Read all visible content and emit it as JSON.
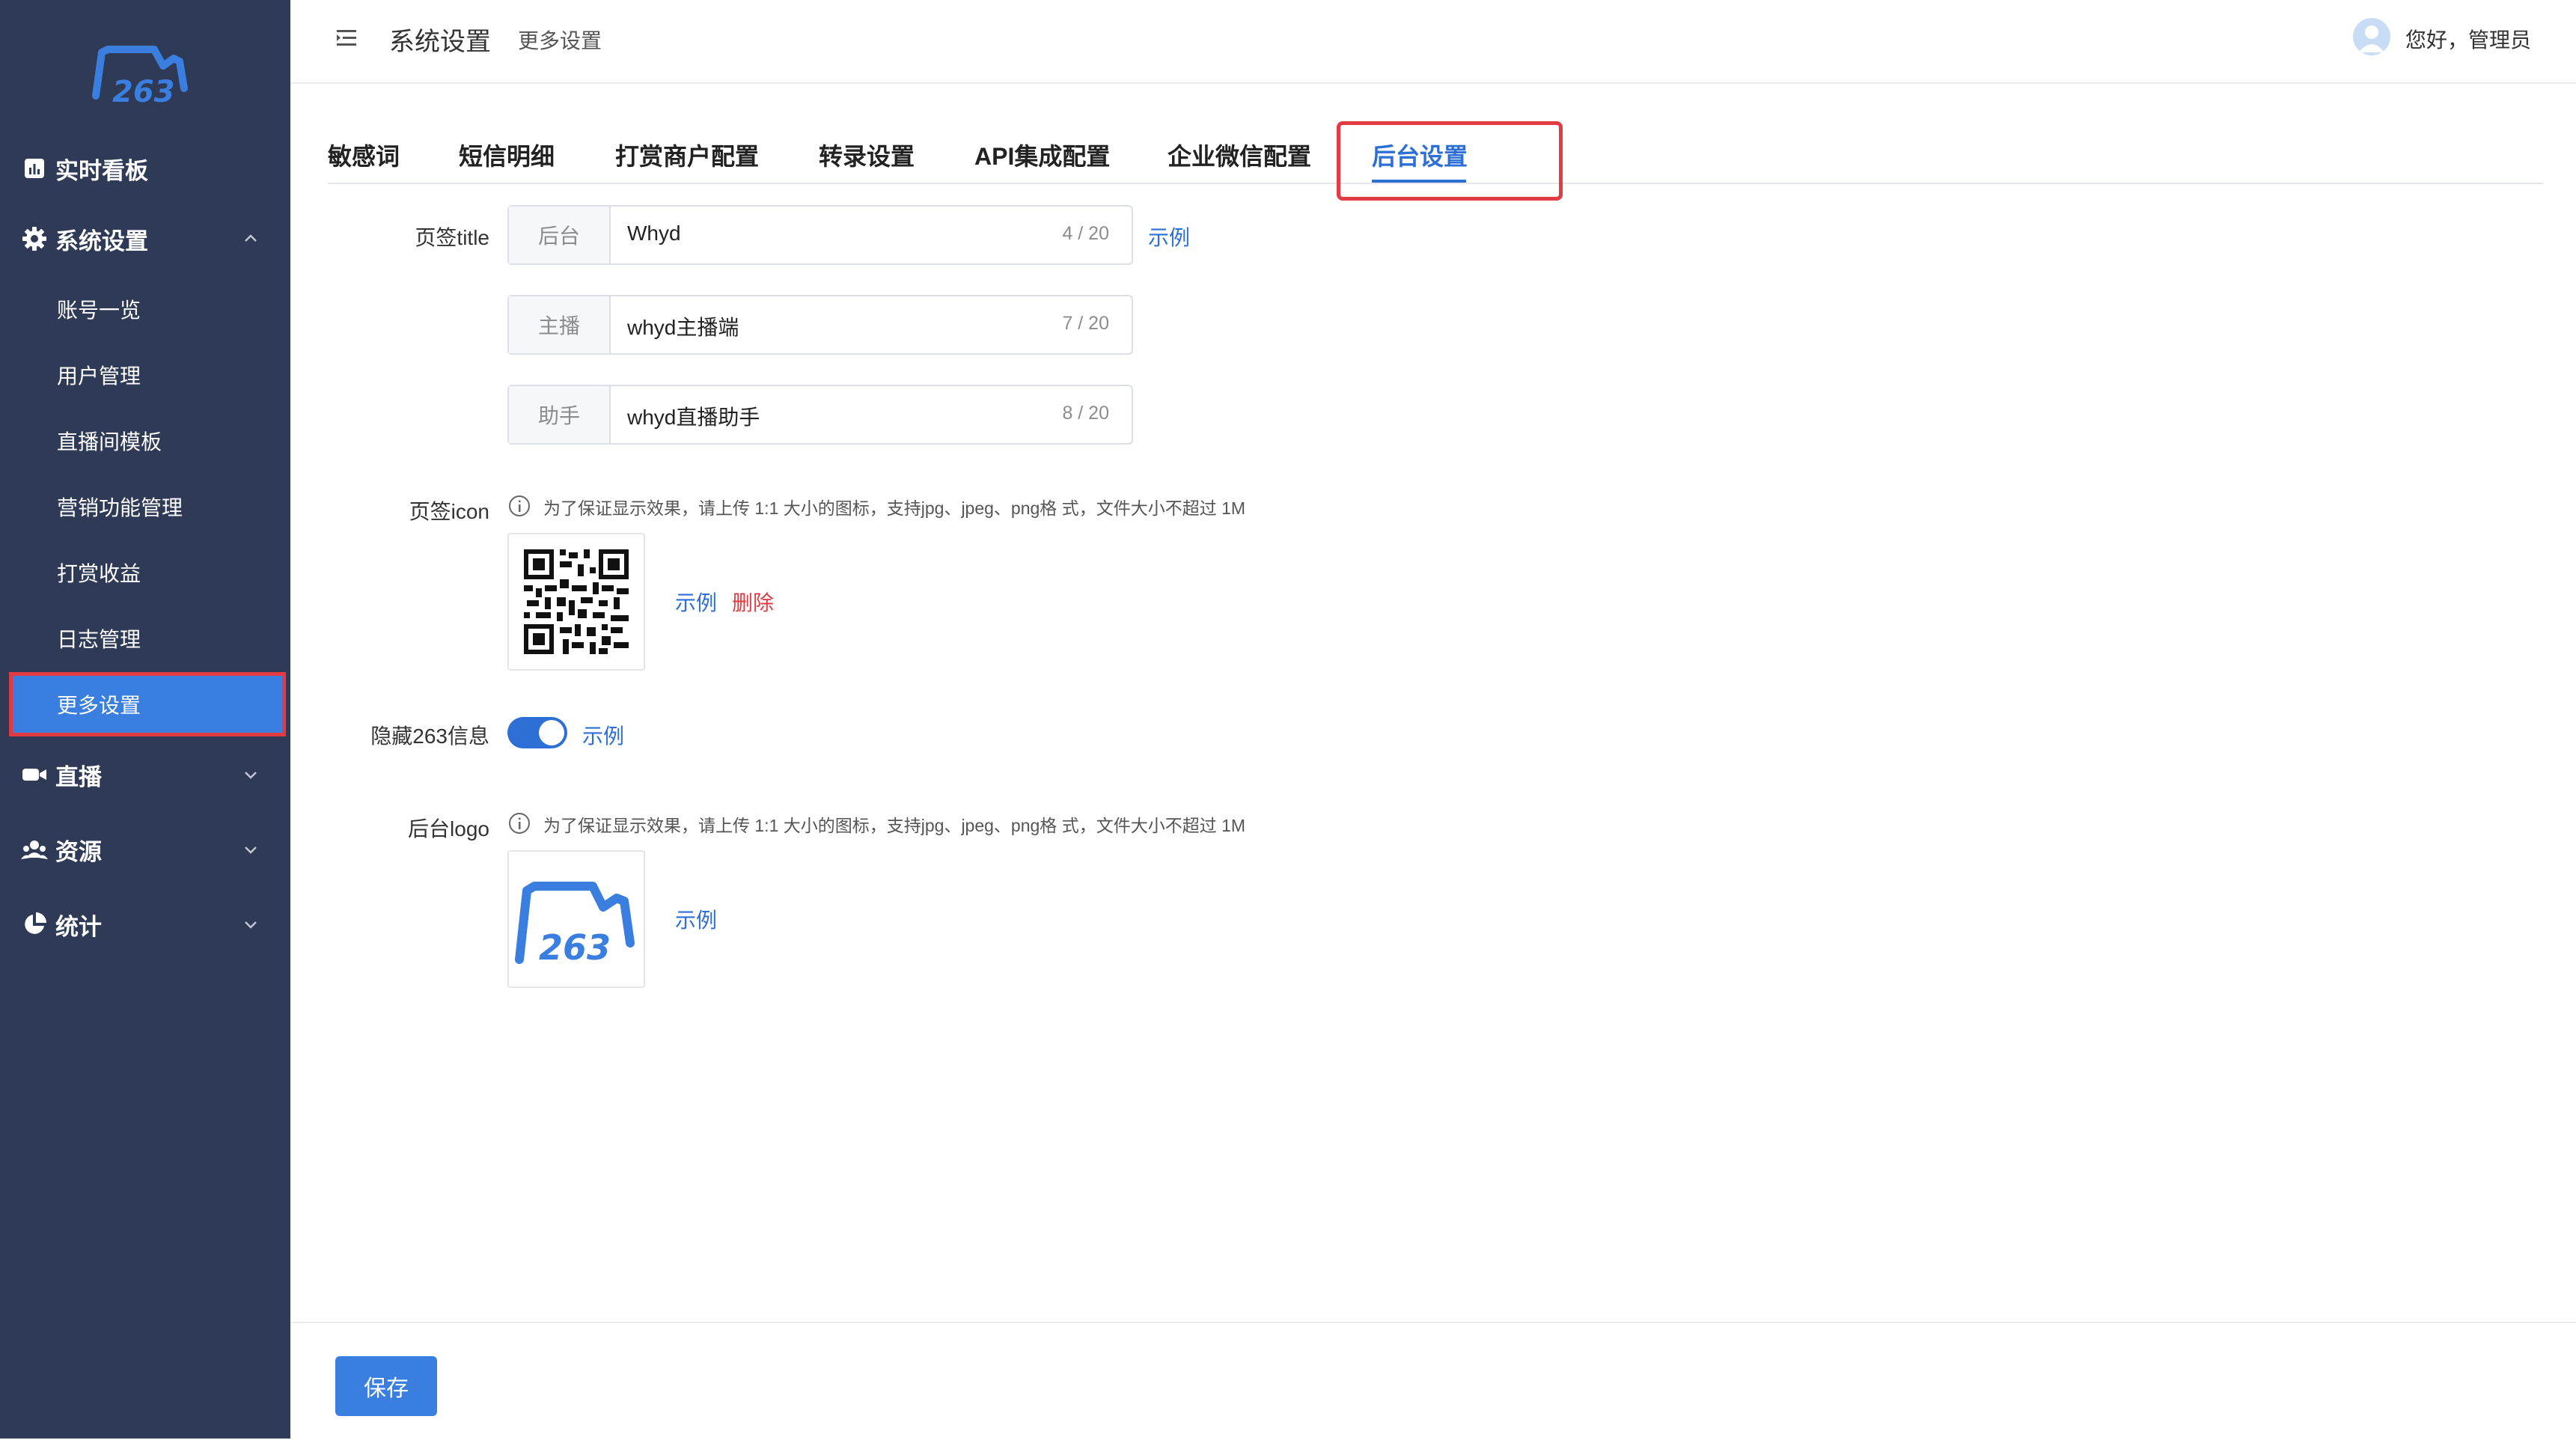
{
  "sidebar": {
    "groups": [
      {
        "label": "实时看板",
        "icon": "bar-chart-icon"
      },
      {
        "label": "系统设置",
        "icon": "gear-icon"
      },
      {
        "label": "直播",
        "icon": "video-camera-icon"
      },
      {
        "label": "资源",
        "icon": "users-icon"
      },
      {
        "label": "统计",
        "icon": "pie-chart-icon"
      }
    ],
    "sub_items": [
      "账号一览",
      "用户管理",
      "直播间模板",
      "营销功能管理",
      "打赏收益",
      "日志管理",
      "更多设置"
    ]
  },
  "header": {
    "breadcrumb_main": "系统设置",
    "breadcrumb_sub": "更多设置",
    "greeting": "您好，管理员"
  },
  "tabs": [
    "敏感词",
    "短信明细",
    "打赏商户配置",
    "转录设置",
    "API集成配置",
    "企业微信配置",
    "后台设置"
  ],
  "form": {
    "title_label": "页签title",
    "title_fields": [
      {
        "prefix": "后台",
        "value": "Whyd",
        "count": "4 / 20"
      },
      {
        "prefix": "主播",
        "value": "whyd主播端",
        "count": "7 / 20"
      },
      {
        "prefix": "助手",
        "value": "whyd直播助手",
        "count": "8 / 20"
      }
    ],
    "example_link": "示例",
    "delete_link": "删除",
    "icon_label": "页签icon",
    "upload_hint": "为了保证显示效果，请上传 1:1 大小的图标，支持jpg、jpeg、png格 式，文件大小不超过 1M",
    "hide_label": "隐藏263信息",
    "hide_toggle_on": true,
    "logo_label": "后台logo",
    "logo_hint": "为了保证显示效果，请上传 1:1 大小的图标，支持jpg、jpeg、png格 式，文件大小不超过 1M",
    "logo_text": "263"
  },
  "footer": {
    "save_label": "保存"
  },
  "colors": {
    "sidebar_bg": "#2f3a56",
    "accent": "#2e6fd6",
    "highlight": "#e23b43"
  }
}
